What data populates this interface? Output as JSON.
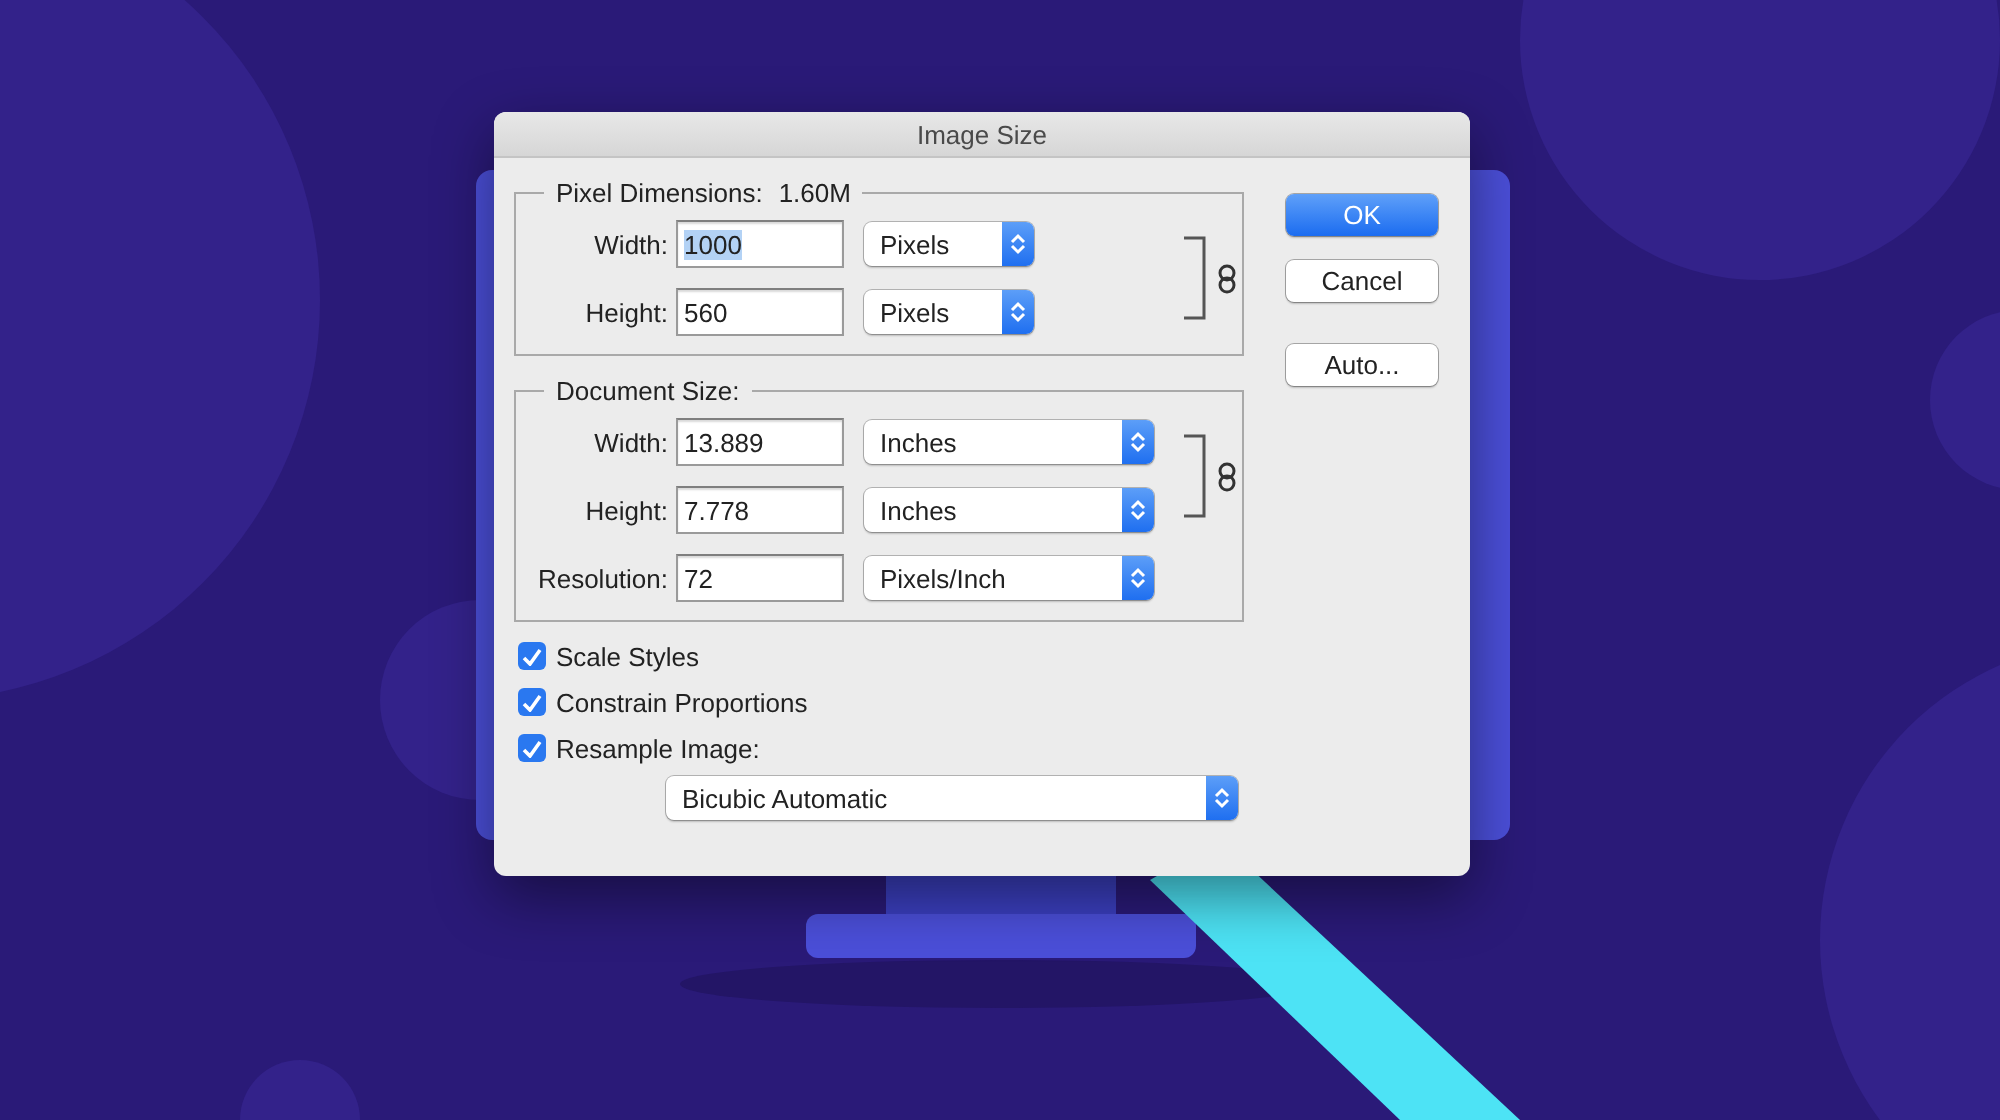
{
  "dialog": {
    "title": "Image Size"
  },
  "pixel_dimensions": {
    "label": "Pixel Dimensions:",
    "value": "1.60M",
    "linked": true,
    "rows": [
      {
        "label": "Width:",
        "value": "1000",
        "highlighted": true,
        "unit": "Pixels"
      },
      {
        "label": "Height:",
        "value": "560",
        "highlighted": false,
        "unit": "Pixels"
      }
    ]
  },
  "document_size": {
    "label": "Document Size:",
    "linked": true,
    "rows": [
      {
        "label": "Width:",
        "value": "13.889",
        "highlighted": false,
        "unit": "Inches"
      },
      {
        "label": "Height:",
        "value": "7.778",
        "highlighted": false,
        "unit": "Inches"
      },
      {
        "label": "Resolution:",
        "value": "72",
        "highlighted": false,
        "unit": "Pixels/Inch"
      }
    ]
  },
  "checkboxes": [
    {
      "label": "Scale Styles",
      "checked": true
    },
    {
      "label": "Constrain Proportions",
      "checked": true
    },
    {
      "label": "Resample Image:",
      "checked": true
    }
  ],
  "resample_method": "Bicubic Automatic",
  "buttons": [
    {
      "label": "OK",
      "default": true
    },
    {
      "label": "Cancel",
      "default": false
    },
    {
      "label": "Auto...",
      "default": false
    }
  ]
}
